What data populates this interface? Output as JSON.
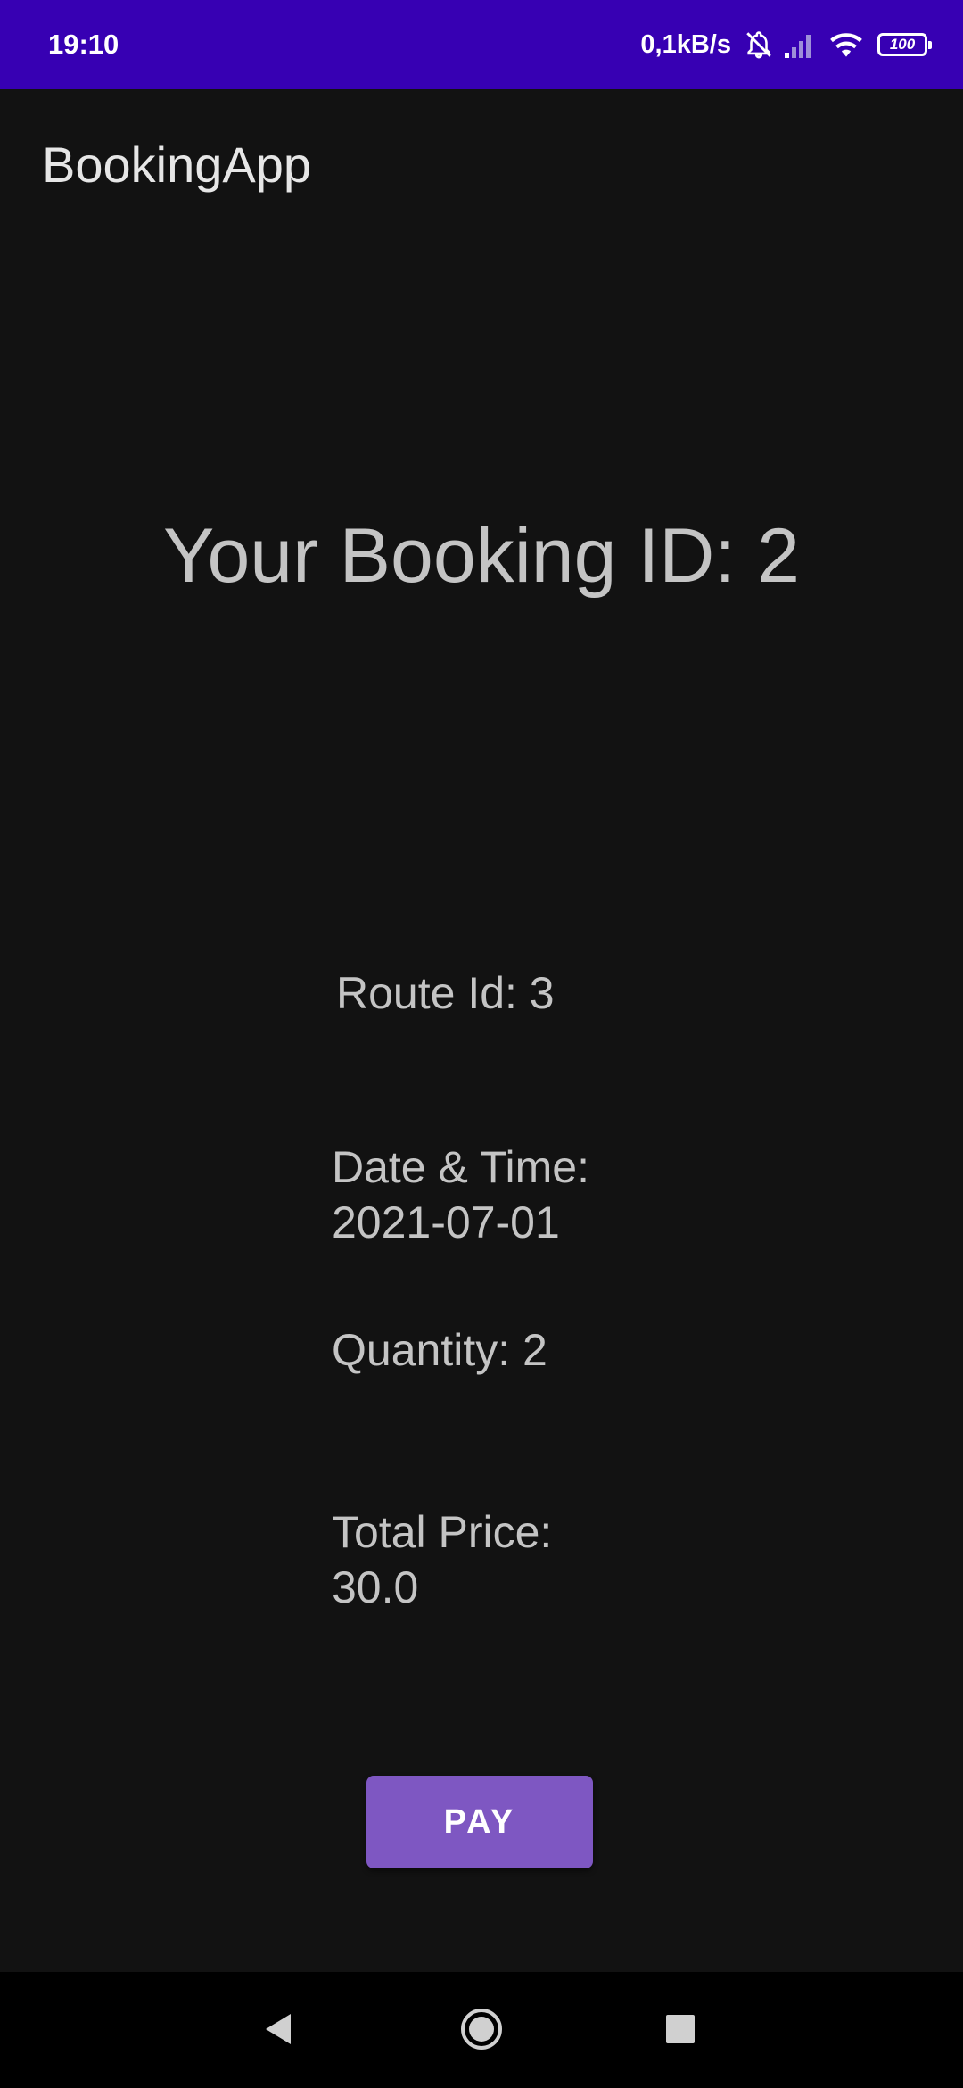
{
  "status_bar": {
    "time": "19:10",
    "net_speed": "0,1kB/s",
    "battery_level": "100",
    "icons": [
      "bell-off-icon",
      "signal-icon",
      "wifi-icon",
      "battery-icon"
    ],
    "background_color": "#3700b3"
  },
  "app_bar": {
    "title": "BookingApp"
  },
  "booking": {
    "heading": "Your Booking ID: 2",
    "route_id": "Route Id: 3",
    "date_time_label": "Date & Time:",
    "date_time_value": "2021-07-01",
    "quantity": "Quantity: 2",
    "total_price_label": "Total Price:",
    "total_price_value": "30.0"
  },
  "actions": {
    "pay_label": "PAY",
    "pay_color": "#7e57c2"
  },
  "nav_bar": {
    "icons": [
      "back-icon",
      "home-icon",
      "recents-icon"
    ]
  },
  "theme": {
    "background": "#121212",
    "text": "#c4c4c4"
  }
}
